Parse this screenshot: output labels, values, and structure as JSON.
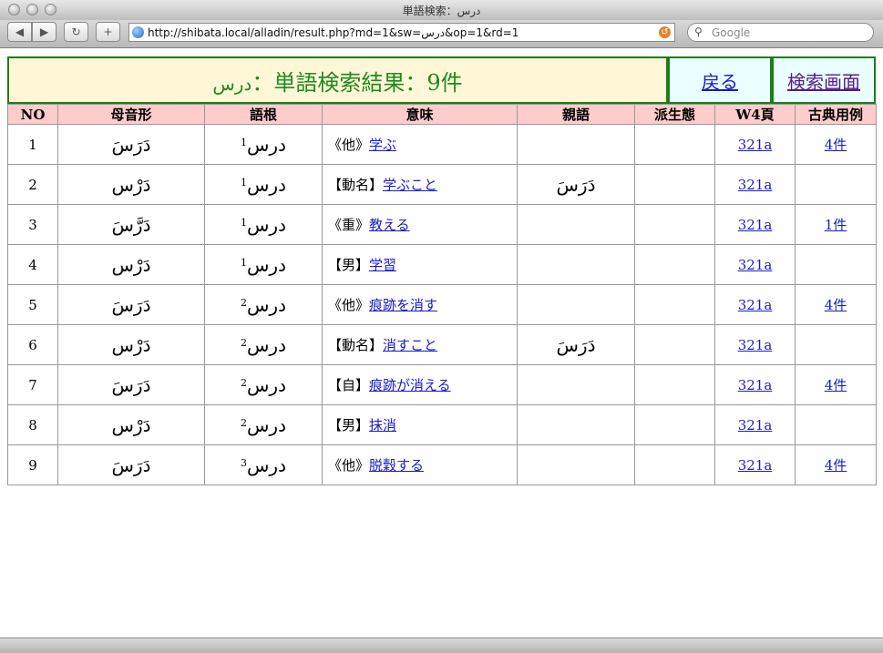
{
  "window": {
    "title": "単語検索：درس"
  },
  "toolbar": {
    "back_glyph": "◀",
    "forward_glyph": "▶",
    "reload_glyph": "↻",
    "add_glyph": "+",
    "url": "http://shibata.local/alladin/result.php?md=1&sw=درس&op=1&rd=1",
    "search_placeholder": "Google"
  },
  "header": {
    "word": "درس",
    "title_text": "：単語検索結果：9件",
    "back_label": "戻る",
    "search_screen_label": "検索画面"
  },
  "table": {
    "columns": [
      "NO",
      "母音形",
      "語根",
      "意味",
      "親語",
      "派生態",
      "W4頁",
      "古典用例"
    ],
    "rows": [
      {
        "no": "1",
        "vowel": "دَرَسَ",
        "root_num": "1",
        "root": "درس",
        "pos": "《他》",
        "meaning": "学ぶ",
        "parent": "",
        "deriv": "",
        "page": "321a",
        "examples": "4件"
      },
      {
        "no": "2",
        "vowel": "دَرْس",
        "root_num": "1",
        "root": "درس",
        "pos": "【動名】",
        "meaning": "学ぶこと",
        "parent": "دَرَسَ",
        "deriv": "",
        "page": "321a",
        "examples": ""
      },
      {
        "no": "3",
        "vowel": "دَرَّسَ",
        "root_num": "1",
        "root": "درس",
        "pos": "《重》",
        "meaning": "教える",
        "parent": "",
        "deriv": "",
        "page": "321a",
        "examples": "1件"
      },
      {
        "no": "4",
        "vowel": "دَرْس",
        "root_num": "1",
        "root": "درس",
        "pos": "【男】",
        "meaning": "学習",
        "parent": "",
        "deriv": "",
        "page": "321a",
        "examples": ""
      },
      {
        "no": "5",
        "vowel": "دَرَسَ",
        "root_num": "2",
        "root": "درس",
        "pos": "《他》",
        "meaning": "痕跡を消す",
        "parent": "",
        "deriv": "",
        "page": "321a",
        "examples": "4件"
      },
      {
        "no": "6",
        "vowel": "دَرْس",
        "root_num": "2",
        "root": "درس",
        "pos": "【動名】",
        "meaning": "消すこと",
        "parent": "دَرَسَ",
        "deriv": "",
        "page": "321a",
        "examples": ""
      },
      {
        "no": "7",
        "vowel": "دَرَسَ",
        "root_num": "2",
        "root": "درس",
        "pos": "【自】",
        "meaning": "痕跡が消える",
        "parent": "",
        "deriv": "",
        "page": "321a",
        "examples": "4件"
      },
      {
        "no": "8",
        "vowel": "دَرْس",
        "root_num": "2",
        "root": "درس",
        "pos": "【男】",
        "meaning": "抹消",
        "parent": "",
        "deriv": "",
        "page": "321a",
        "examples": ""
      },
      {
        "no": "9",
        "vowel": "دَرَسَ",
        "root_num": "3",
        "root": "درس",
        "pos": "《他》",
        "meaning": "脱穀する",
        "parent": "",
        "deriv": "",
        "page": "321a",
        "examples": "4件"
      }
    ]
  }
}
